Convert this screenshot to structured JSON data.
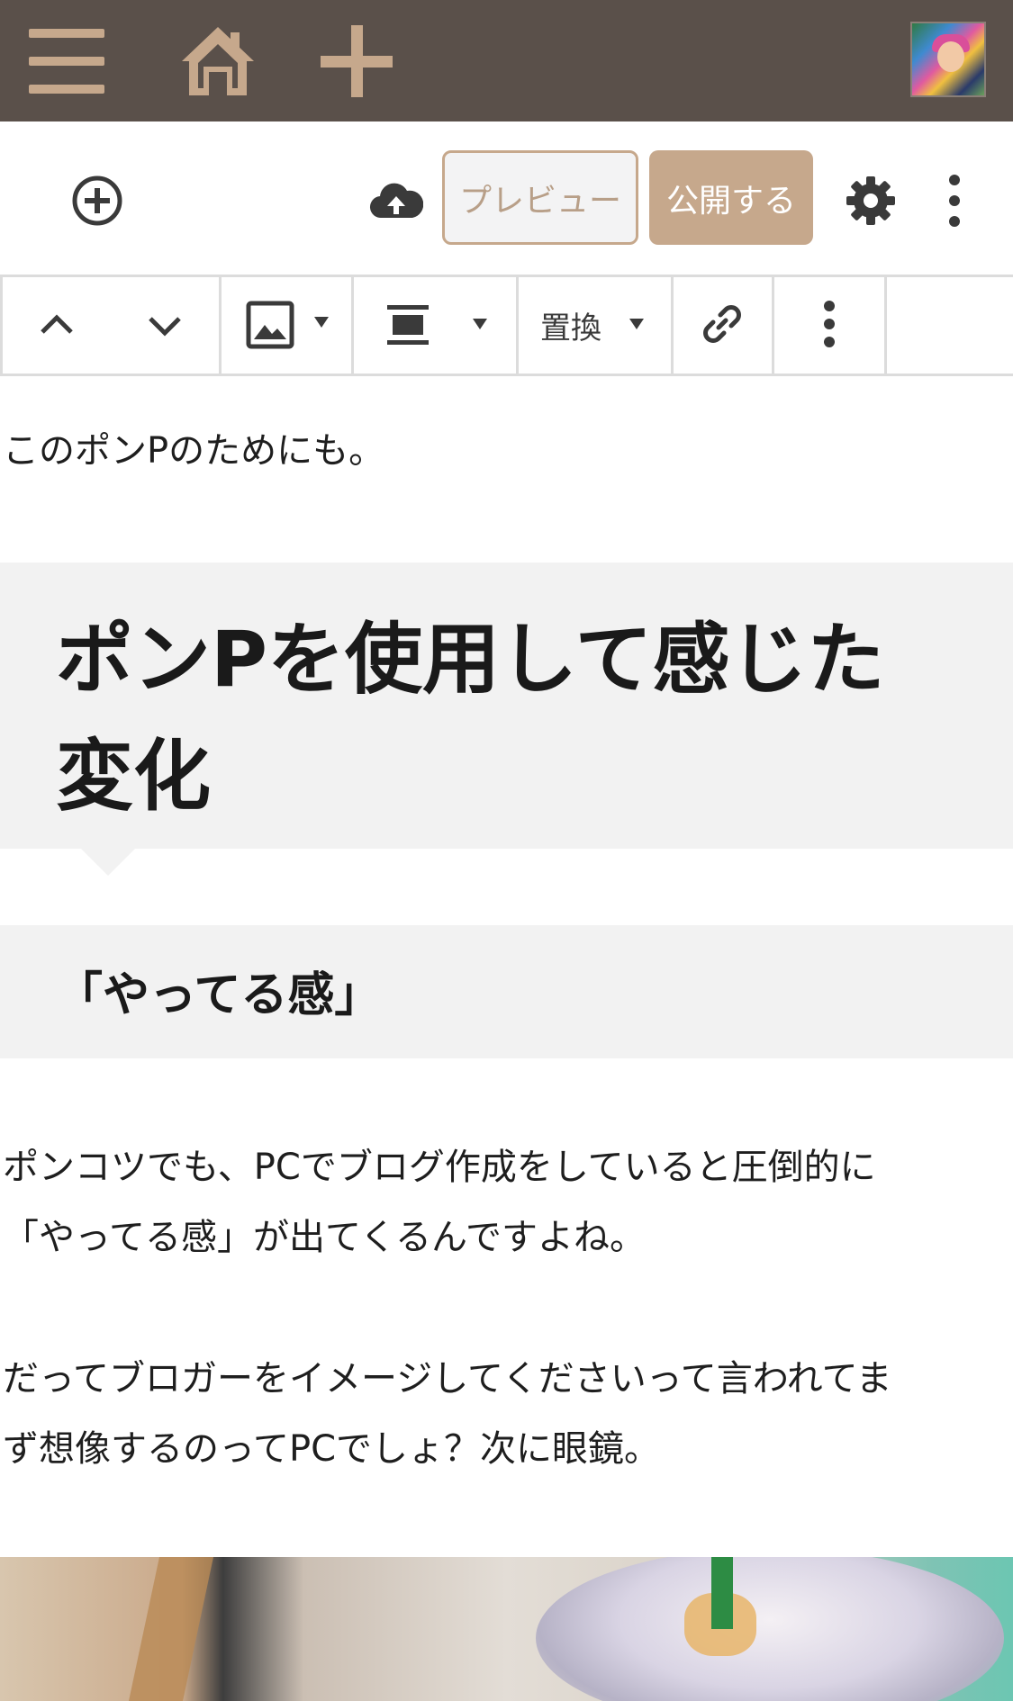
{
  "topbar": {
    "menu_icon": "hamburger-menu-icon",
    "home_icon": "home-icon",
    "add_icon": "plus-icon",
    "avatar": "user-avatar",
    "bg_color": "#5a504a",
    "icon_color": "#c6a88c"
  },
  "header": {
    "add_block_icon": "plus-circle-icon",
    "save_icon": "cloud-upload-icon",
    "preview_label": "プレビュー",
    "publish_label": "公開する",
    "settings_icon": "gear-icon",
    "more_icon": "vertical-dots-icon"
  },
  "block_toolbar": {
    "move_up_icon": "chevron-up-icon",
    "move_down_icon": "chevron-down-icon",
    "image_icon": "image-icon",
    "align_icon": "align-center-icon",
    "replace_label": "置換",
    "link_icon": "link-icon",
    "more_icon": "vertical-dots-icon"
  },
  "content": {
    "para1": "このポンPのためにも。",
    "heading2": "ポンPを使用して感じた変化",
    "heading3": "「やってる感」",
    "para2_line1": "ポンコツでも、PCでブログ作成をしていると圧倒的に",
    "para2_line2": "「やってる感」が出てくるんですよね。",
    "para3_line1": "だってブロガーをイメージしてくださいって言われてま",
    "para3_line2": "ず想像するのってPCでしょ？次に眼鏡。"
  },
  "image": {
    "alt": ""
  }
}
